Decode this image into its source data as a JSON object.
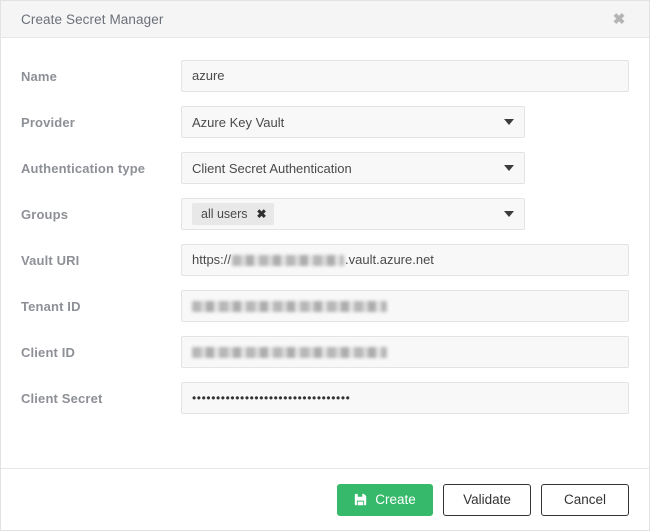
{
  "dialog": {
    "title": "Create Secret Manager",
    "close_icon": "close-icon",
    "close_glyph": "✖"
  },
  "form": {
    "fields": [
      {
        "label": "Name",
        "type": "text",
        "value": "azure"
      },
      {
        "label": "Provider",
        "type": "select",
        "value": "Azure Key Vault"
      },
      {
        "label": "Authentication type",
        "type": "select",
        "value": "Client Secret Authentication"
      },
      {
        "label": "Groups",
        "type": "tags",
        "tags": [
          {
            "label": "all users",
            "remove_glyph": "✖"
          }
        ]
      },
      {
        "label": "Vault URI",
        "type": "text-redacted",
        "prefix": "https://",
        "redacted": "██████████",
        "suffix": ".vault.azure.net"
      },
      {
        "label": "Tenant ID",
        "type": "redacted",
        "redacted": "█████████████████"
      },
      {
        "label": "Client ID",
        "type": "redacted",
        "redacted": "█████████████████"
      },
      {
        "label": "Client Secret",
        "type": "password",
        "value": "•••••••••••••••••••••••••••••••••"
      }
    ]
  },
  "footer": {
    "create_label": "Create",
    "create_icon": "save-icon",
    "validate_label": "Validate",
    "cancel_label": "Cancel"
  },
  "colors": {
    "accent_green": "#36b96a",
    "header_bg": "#f5f5f5",
    "input_bg": "#f8f8f8",
    "input_border": "#e4e4e4",
    "label_text": "#8d9096",
    "value_text": "#4a4a4a",
    "button_border": "#333333"
  }
}
